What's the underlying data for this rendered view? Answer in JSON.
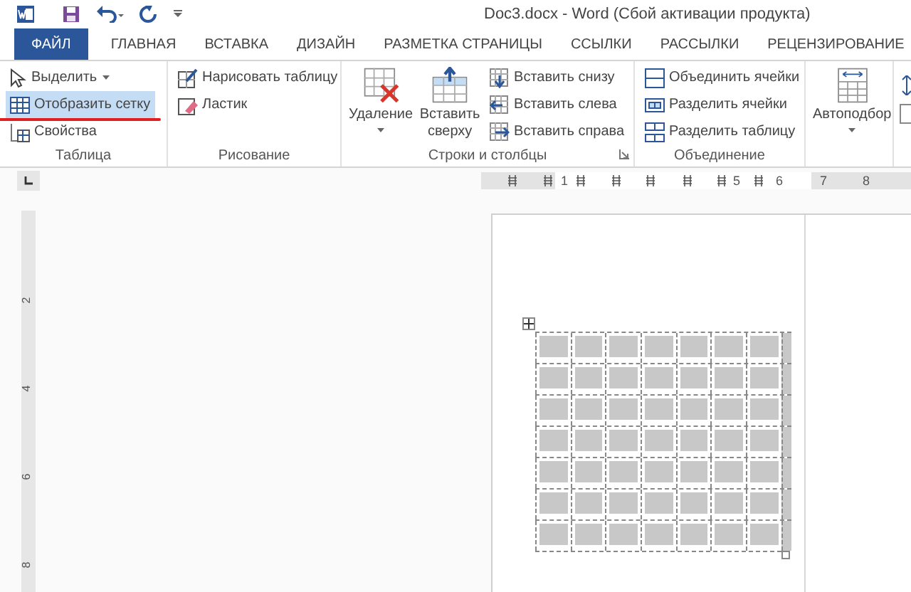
{
  "title_bar": {
    "title": "Doc3.docx - Word (Сбой активации продукта)"
  },
  "tabs": [
    {
      "label": "ФАЙЛ",
      "kind": "file",
      "selected": false
    },
    {
      "label": "ГЛАВНАЯ",
      "kind": "tab",
      "selected": false
    },
    {
      "label": "ВСТАВКА",
      "kind": "tab",
      "selected": false
    },
    {
      "label": "ДИЗАЙН",
      "kind": "tab",
      "selected": false
    },
    {
      "label": "РАЗМЕТКА СТРАНИЦЫ",
      "kind": "tab",
      "selected": false
    },
    {
      "label": "ССЫЛКИ",
      "kind": "tab",
      "selected": false
    },
    {
      "label": "РАССЫЛКИ",
      "kind": "tab",
      "selected": false
    },
    {
      "label": "РЕЦЕНЗИРОВАНИЕ",
      "kind": "tab",
      "selected": false
    }
  ],
  "ribbon": {
    "groups": [
      {
        "label": "Таблица",
        "columns": [
          [
            {
              "label": "Выделить",
              "kind": "small",
              "dropdown": true,
              "on": false,
              "underlined": false
            },
            {
              "label": "Отобразить сетку",
              "kind": "small",
              "dropdown": false,
              "on": true,
              "underlined": true
            },
            {
              "label": "Свойства",
              "kind": "small",
              "dropdown": false,
              "on": false,
              "underlined": false
            }
          ]
        ]
      },
      {
        "label": "Рисование",
        "columns": [
          [
            {
              "label": "Нарисовать таблицу",
              "kind": "small",
              "dropdown": false,
              "on": false,
              "underlined": false
            },
            {
              "label": "Ластик",
              "kind": "small",
              "dropdown": false,
              "on": false,
              "underlined": false
            }
          ]
        ]
      },
      {
        "label": "Строки и столбцы",
        "launcher": true,
        "columns": [
          [
            {
              "label": "Удаление",
              "kind": "large",
              "dropdown": true,
              "on": false,
              "underlined": false
            }
          ],
          [
            {
              "label": "Вставить сверху",
              "kind": "large",
              "dropdown": false,
              "on": false,
              "underlined": false
            }
          ],
          [
            {
              "label": "Вставить снизу",
              "kind": "small",
              "dropdown": false,
              "on": false,
              "underlined": false
            },
            {
              "label": "Вставить слева",
              "kind": "small",
              "dropdown": false,
              "on": false,
              "underlined": false
            },
            {
              "label": "Вставить справа",
              "kind": "small",
              "dropdown": false,
              "on": false,
              "underlined": false
            }
          ]
        ]
      },
      {
        "label": "Объединение",
        "columns": [
          [
            {
              "label": "Объединить ячейки",
              "kind": "small",
              "dropdown": false,
              "on": false,
              "underlined": false
            },
            {
              "label": "Разделить ячейки",
              "kind": "small",
              "dropdown": false,
              "on": false,
              "underlined": false
            },
            {
              "label": "Разделить таблицу",
              "kind": "small",
              "dropdown": false,
              "on": false,
              "underlined": false
            }
          ]
        ]
      },
      {
        "columns": [
          [
            {
              "label": "Автоподбор",
              "kind": "large",
              "dropdown": true,
              "on": false,
              "underlined": false
            }
          ]
        ]
      }
    ]
  },
  "ruler": {
    "labels": [
      "1",
      "5",
      "6",
      "7",
      "8"
    ]
  },
  "vertical_ruler": {
    "labels": [
      "2",
      "4",
      "6",
      "8"
    ]
  }
}
